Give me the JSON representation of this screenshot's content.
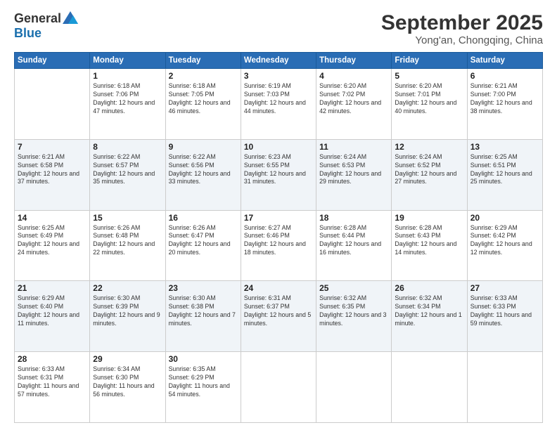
{
  "logo": {
    "general": "General",
    "blue": "Blue"
  },
  "title": "September 2025",
  "location": "Yong'an, Chongqing, China",
  "days_of_week": [
    "Sunday",
    "Monday",
    "Tuesday",
    "Wednesday",
    "Thursday",
    "Friday",
    "Saturday"
  ],
  "weeks": [
    [
      {
        "day": "",
        "info": ""
      },
      {
        "day": "1",
        "info": "Sunrise: 6:18 AM\nSunset: 7:06 PM\nDaylight: 12 hours\nand 47 minutes."
      },
      {
        "day": "2",
        "info": "Sunrise: 6:18 AM\nSunset: 7:05 PM\nDaylight: 12 hours\nand 46 minutes."
      },
      {
        "day": "3",
        "info": "Sunrise: 6:19 AM\nSunset: 7:03 PM\nDaylight: 12 hours\nand 44 minutes."
      },
      {
        "day": "4",
        "info": "Sunrise: 6:20 AM\nSunset: 7:02 PM\nDaylight: 12 hours\nand 42 minutes."
      },
      {
        "day": "5",
        "info": "Sunrise: 6:20 AM\nSunset: 7:01 PM\nDaylight: 12 hours\nand 40 minutes."
      },
      {
        "day": "6",
        "info": "Sunrise: 6:21 AM\nSunset: 7:00 PM\nDaylight: 12 hours\nand 38 minutes."
      }
    ],
    [
      {
        "day": "7",
        "info": "Sunrise: 6:21 AM\nSunset: 6:58 PM\nDaylight: 12 hours\nand 37 minutes."
      },
      {
        "day": "8",
        "info": "Sunrise: 6:22 AM\nSunset: 6:57 PM\nDaylight: 12 hours\nand 35 minutes."
      },
      {
        "day": "9",
        "info": "Sunrise: 6:22 AM\nSunset: 6:56 PM\nDaylight: 12 hours\nand 33 minutes."
      },
      {
        "day": "10",
        "info": "Sunrise: 6:23 AM\nSunset: 6:55 PM\nDaylight: 12 hours\nand 31 minutes."
      },
      {
        "day": "11",
        "info": "Sunrise: 6:24 AM\nSunset: 6:53 PM\nDaylight: 12 hours\nand 29 minutes."
      },
      {
        "day": "12",
        "info": "Sunrise: 6:24 AM\nSunset: 6:52 PM\nDaylight: 12 hours\nand 27 minutes."
      },
      {
        "day": "13",
        "info": "Sunrise: 6:25 AM\nSunset: 6:51 PM\nDaylight: 12 hours\nand 25 minutes."
      }
    ],
    [
      {
        "day": "14",
        "info": "Sunrise: 6:25 AM\nSunset: 6:49 PM\nDaylight: 12 hours\nand 24 minutes."
      },
      {
        "day": "15",
        "info": "Sunrise: 6:26 AM\nSunset: 6:48 PM\nDaylight: 12 hours\nand 22 minutes."
      },
      {
        "day": "16",
        "info": "Sunrise: 6:26 AM\nSunset: 6:47 PM\nDaylight: 12 hours\nand 20 minutes."
      },
      {
        "day": "17",
        "info": "Sunrise: 6:27 AM\nSunset: 6:46 PM\nDaylight: 12 hours\nand 18 minutes."
      },
      {
        "day": "18",
        "info": "Sunrise: 6:28 AM\nSunset: 6:44 PM\nDaylight: 12 hours\nand 16 minutes."
      },
      {
        "day": "19",
        "info": "Sunrise: 6:28 AM\nSunset: 6:43 PM\nDaylight: 12 hours\nand 14 minutes."
      },
      {
        "day": "20",
        "info": "Sunrise: 6:29 AM\nSunset: 6:42 PM\nDaylight: 12 hours\nand 12 minutes."
      }
    ],
    [
      {
        "day": "21",
        "info": "Sunrise: 6:29 AM\nSunset: 6:40 PM\nDaylight: 12 hours\nand 11 minutes."
      },
      {
        "day": "22",
        "info": "Sunrise: 6:30 AM\nSunset: 6:39 PM\nDaylight: 12 hours\nand 9 minutes."
      },
      {
        "day": "23",
        "info": "Sunrise: 6:30 AM\nSunset: 6:38 PM\nDaylight: 12 hours\nand 7 minutes."
      },
      {
        "day": "24",
        "info": "Sunrise: 6:31 AM\nSunset: 6:37 PM\nDaylight: 12 hours\nand 5 minutes."
      },
      {
        "day": "25",
        "info": "Sunrise: 6:32 AM\nSunset: 6:35 PM\nDaylight: 12 hours\nand 3 minutes."
      },
      {
        "day": "26",
        "info": "Sunrise: 6:32 AM\nSunset: 6:34 PM\nDaylight: 12 hours\nand 1 minute."
      },
      {
        "day": "27",
        "info": "Sunrise: 6:33 AM\nSunset: 6:33 PM\nDaylight: 11 hours\nand 59 minutes."
      }
    ],
    [
      {
        "day": "28",
        "info": "Sunrise: 6:33 AM\nSunset: 6:31 PM\nDaylight: 11 hours\nand 57 minutes."
      },
      {
        "day": "29",
        "info": "Sunrise: 6:34 AM\nSunset: 6:30 PM\nDaylight: 11 hours\nand 56 minutes."
      },
      {
        "day": "30",
        "info": "Sunrise: 6:35 AM\nSunset: 6:29 PM\nDaylight: 11 hours\nand 54 minutes."
      },
      {
        "day": "",
        "info": ""
      },
      {
        "day": "",
        "info": ""
      },
      {
        "day": "",
        "info": ""
      },
      {
        "day": "",
        "info": ""
      }
    ]
  ]
}
